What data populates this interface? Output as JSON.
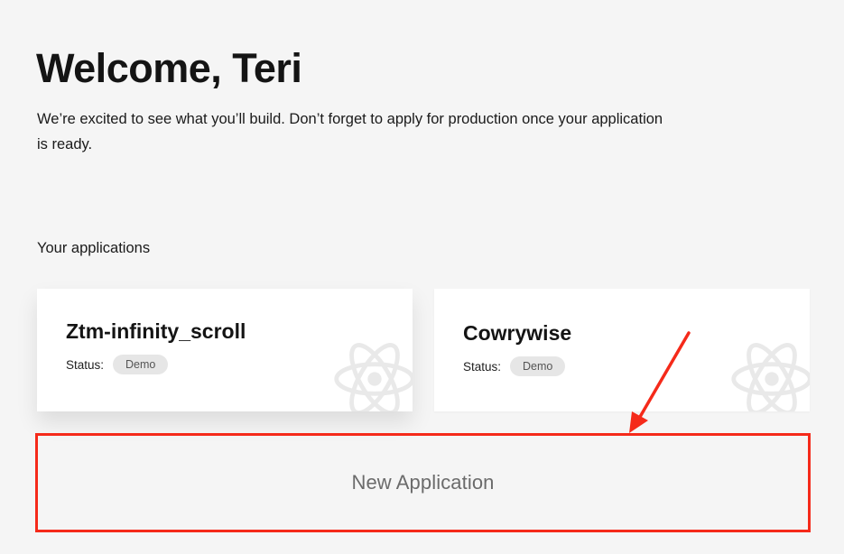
{
  "page": {
    "heading": "Welcome, Teri",
    "intro": "We’re excited to see what you’ll build. Don’t forget to apply for production once your application is ready."
  },
  "applications": {
    "section_title": "Your applications",
    "items": [
      {
        "name": "Ztm-infinity_scroll",
        "status_label": "Status:",
        "status": "Demo",
        "icon": "react-atom-icon"
      },
      {
        "name": "Cowrywise",
        "status_label": "Status:",
        "status": "Demo",
        "icon": "react-atom-icon"
      }
    ]
  },
  "new_application": {
    "label": "New Application"
  },
  "annotation": {
    "highlight_color": "#f52a1a",
    "arrow_icon": "red-arrow-icon"
  }
}
